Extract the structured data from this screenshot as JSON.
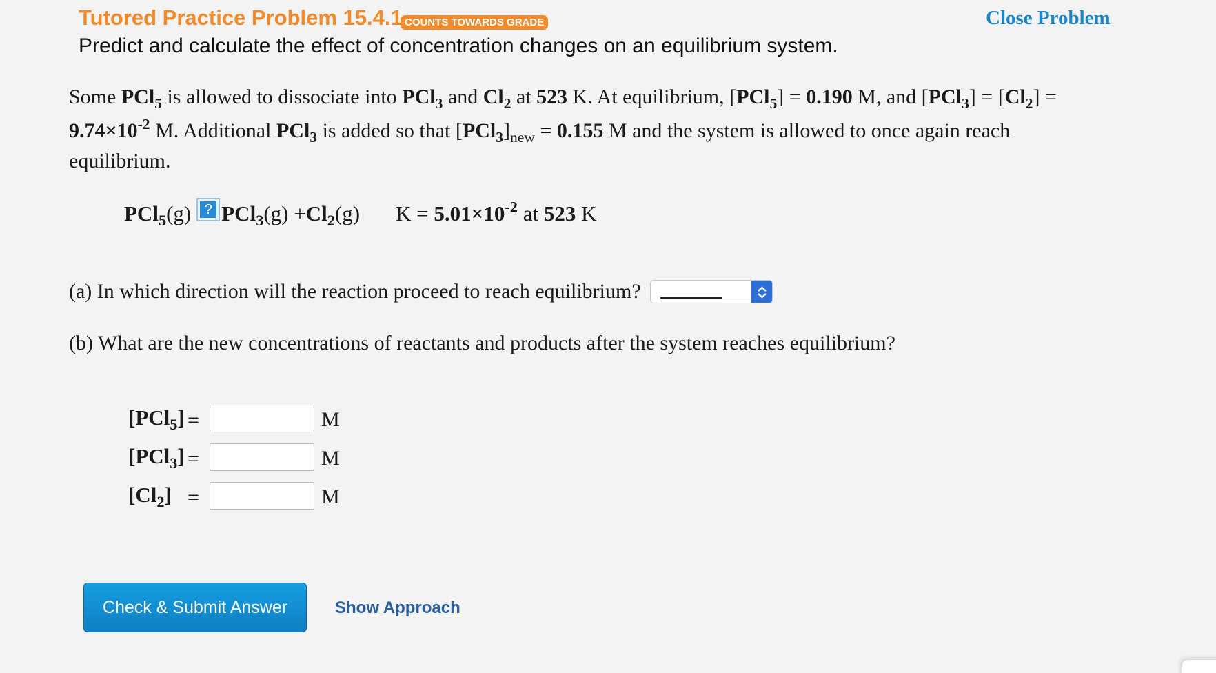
{
  "header": {
    "title": "Tutored Practice Problem 15.4.1",
    "badge": "COUNTS TOWARDS GRADE",
    "close_link": "Close Problem",
    "subtitle": "Predict and calculate the effect of concentration changes on an equilibrium system."
  },
  "problem": {
    "line1": {
      "t1": "Some ",
      "pcl5": "PCl",
      "sub5": "5",
      "t2": " is allowed to dissociate into ",
      "pcl3": "PCl",
      "sub3": "3",
      "t3": " and ",
      "cl2": "Cl",
      "sub2": "2",
      "t4": " at ",
      "temp": "523",
      "t5": " K. At equilibrium, [",
      "pcl5b": "PCl",
      "sub5b": "5",
      "t6": "] = ",
      "conc_pcl5": "0.190",
      "t7": " M, and [",
      "pcl3b": "PCl",
      "sub3b": "3",
      "t8": "] = [",
      "cl2b": "Cl",
      "sub2b": "2",
      "t9": "] ="
    },
    "line2": {
      "conc_base": "9.74×10",
      "conc_exp": "-2",
      "t1": " M. Additional ",
      "pcl3": "PCl",
      "sub3": "3",
      "t2": " is added so that [",
      "pcl3b": "PCl",
      "sub3b": "3",
      "t3": "]",
      "new_sub": "new",
      "t4": " = ",
      "new_conc": "0.155",
      "t5": " M and the system is allowed to once again reach"
    },
    "line3": "equilibrium."
  },
  "equation": {
    "reactant": "PCl",
    "reactant_sub": "5",
    "reactant_state": "(g)",
    "help_glyph": "?",
    "product1": "PCl",
    "product1_sub": "3",
    "product1_state": "(g) + ",
    "product2": "Cl",
    "product2_sub": "2",
    "product2_state": "(g)",
    "k_prefix": "K = ",
    "k_base": "5.01×10",
    "k_exp": "-2",
    "k_at": " at ",
    "k_temp": "523",
    "k_unit": " K"
  },
  "question_a": {
    "text": "(a) In which direction will the reaction proceed to reach equilibrium?"
  },
  "question_b": {
    "text": "(b) What are the new concentrations of reactants and products after the system reaches equilibrium?"
  },
  "concentrations": [
    {
      "open": "[",
      "species": "PCl",
      "sub": "5",
      "close": "]",
      "equals": "=",
      "value": "",
      "unit": "M"
    },
    {
      "open": "[",
      "species": "PCl",
      "sub": "3",
      "close": "]",
      "equals": "=",
      "value": "",
      "unit": "M"
    },
    {
      "open": "[",
      "species": "Cl",
      "sub": "2",
      "close": "]",
      "equals": "=",
      "value": "",
      "unit": "M"
    }
  ],
  "buttons": {
    "submit": "Check & Submit Answer",
    "approach": "Show Approach"
  },
  "icons": {
    "help": "help-question-icon",
    "select_arrows": "chevron-up-down-icon"
  },
  "colors": {
    "title_orange": "#f08a2a",
    "link_blue": "#1a86c7",
    "button_blue": "#179ee2",
    "select_blue": "#2c6fd6"
  }
}
